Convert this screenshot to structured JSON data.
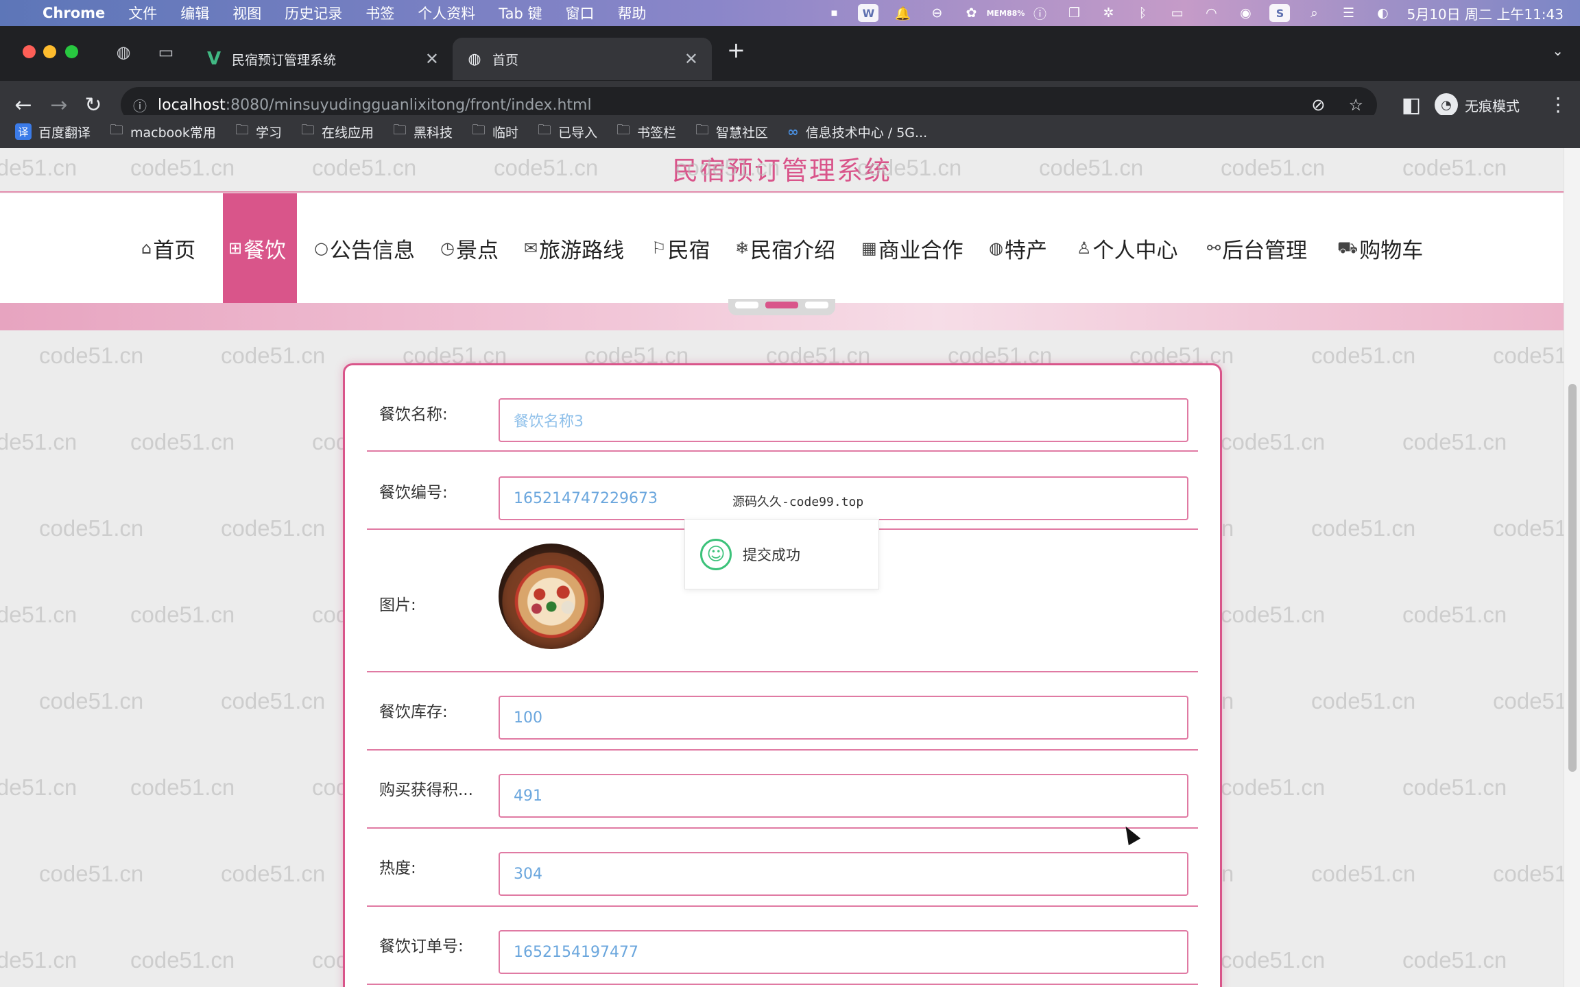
{
  "menubar": {
    "apple_icon": "apple-icon",
    "app_name": "Chrome",
    "menus": [
      "文件",
      "编辑",
      "视图",
      "历史记录",
      "书签",
      "个人资料",
      "Tab 键",
      "窗口",
      "帮助"
    ],
    "mem_label": "MEM",
    "mem_value": "88%",
    "clock": "5月10日 周二 上午11:43"
  },
  "tabs": {
    "tab1_title": "民宿预订管理系统",
    "tab2_title": "首页",
    "close_glyph": "✕",
    "new_tab_glyph": "+"
  },
  "address": {
    "host": "localhost",
    "path": ":8080/minsuyudingguanlixitong/front/index.html"
  },
  "incognito_label": "无痕模式",
  "bookmarks": [
    {
      "label": "百度翻译",
      "icon": "translate-icon"
    },
    {
      "label": "macbook常用",
      "icon": "folder-icon"
    },
    {
      "label": "学习",
      "icon": "folder-icon"
    },
    {
      "label": "在线应用",
      "icon": "folder-icon"
    },
    {
      "label": "黑科技",
      "icon": "folder-icon"
    },
    {
      "label": "临时",
      "icon": "folder-icon"
    },
    {
      "label": "已导入",
      "icon": "folder-icon"
    },
    {
      "label": "书签栏",
      "icon": "folder-icon"
    },
    {
      "label": "智慧社区",
      "icon": "folder-icon"
    },
    {
      "label": "信息技术中心 / 5G...",
      "icon": "link-icon"
    }
  ],
  "site": {
    "title": "民宿预订管理系统",
    "watermark": "code51.cn",
    "nav": [
      {
        "label": "首页",
        "glyph": "⌂"
      },
      {
        "label": "餐饮",
        "glyph": "⊞"
      },
      {
        "label": "公告信息",
        "glyph": "○"
      },
      {
        "label": "景点",
        "glyph": "◷"
      },
      {
        "label": "旅游路线",
        "glyph": "✉"
      },
      {
        "label": "民宿",
        "glyph": "⚐"
      },
      {
        "label": "民宿介绍",
        "glyph": "❄"
      },
      {
        "label": "商业合作",
        "glyph": "▦"
      },
      {
        "label": "特产",
        "glyph": "◍"
      },
      {
        "label": "个人中心",
        "glyph": "♙"
      },
      {
        "label": "后台管理",
        "glyph": "⚯"
      },
      {
        "label": "购物车",
        "glyph": "⛟"
      }
    ],
    "active_nav": "餐饮"
  },
  "form": {
    "name_label": "餐饮名称:",
    "name_value": "餐饮名称3",
    "code_label": "餐饮编号:",
    "code_value": "165214747229673",
    "image_label": "图片:",
    "stock_label": "餐饮库存:",
    "stock_value": "100",
    "points_label": "购买获得积...",
    "points_value": "491",
    "heat_label": "热度:",
    "heat_value": "304",
    "order_label": "餐饮订单号:",
    "order_value": "1652154197477"
  },
  "toast": {
    "message": "提交成功",
    "overlay": "源码久久-code99.top"
  }
}
